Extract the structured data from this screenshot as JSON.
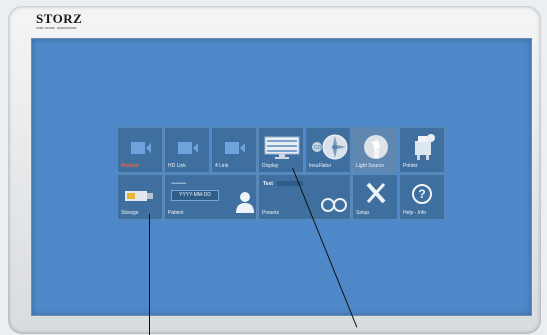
{
  "brand": {
    "name": "STORZ",
    "tagline": "KARL STORZ · ENDOSKOPE"
  },
  "tiles": [
    {
      "label": "Modulo",
      "icon": "camera-icon",
      "active": true
    },
    {
      "label": "HD Link",
      "icon": "camera-icon"
    },
    {
      "label": "4 Link",
      "icon": "camera-icon"
    },
    {
      "label": "Display",
      "icon": "monitor-icon"
    },
    {
      "label": "InsuFlator",
      "icon": "insufflator-icon"
    },
    {
      "label": "Light Source",
      "icon": "light-source-icon"
    },
    {
      "label": "Printer",
      "icon": "printer-icon"
    },
    {
      "label": "Storage",
      "icon": "usb-storage-icon"
    },
    {
      "label": "Patient",
      "icon": "patient-icon",
      "id_mask": "**************",
      "date_text": "YYYY-MM-DD"
    },
    {
      "label": "",
      "icon": "blank"
    },
    {
      "label": "Presets",
      "icon": "presets-icon",
      "preset_name": "Test"
    },
    {
      "label": "Setup",
      "icon": "tools-icon"
    },
    {
      "label": "Help - Info",
      "icon": "help-icon",
      "glyph": "?"
    }
  ],
  "colors": {
    "screen": "#4e88c8",
    "tile": "#3f6f9f",
    "active_label": "#e8623d"
  }
}
